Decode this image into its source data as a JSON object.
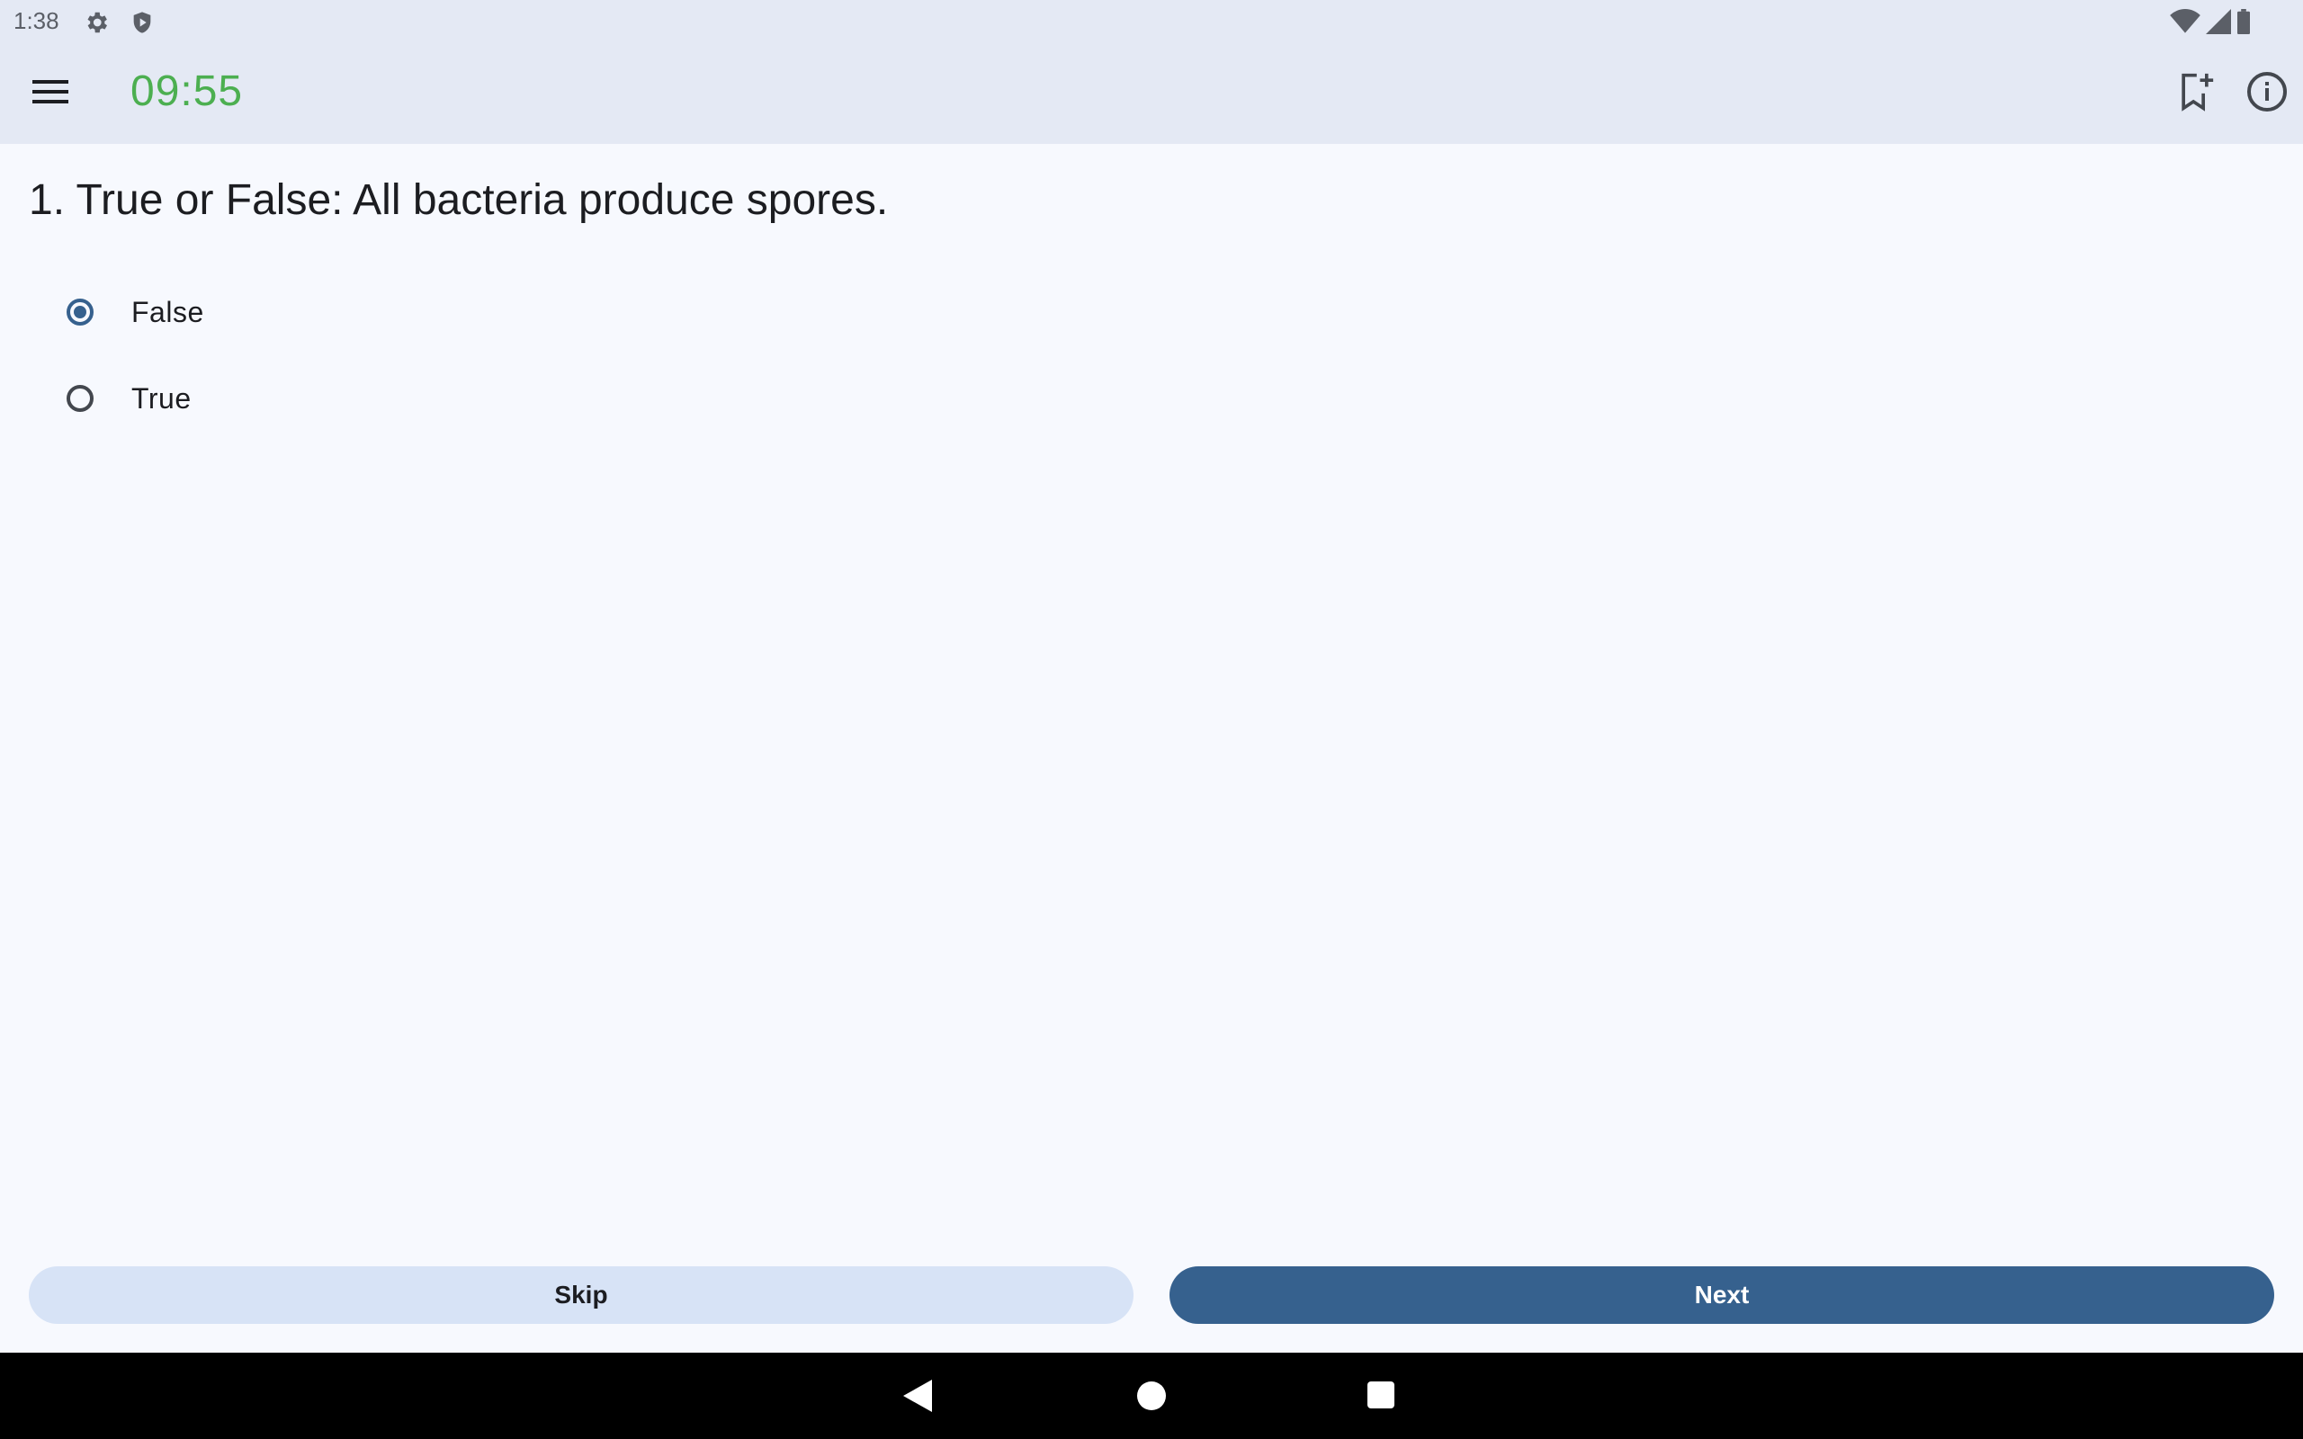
{
  "status_bar": {
    "time": "1:38",
    "icons": [
      "gear-icon",
      "shield-icon",
      "wifi-icon",
      "signal-icon",
      "battery-icon"
    ]
  },
  "app_bar": {
    "timer": "09:55",
    "timer_color": "#4caf50",
    "icons": [
      "menu-icon",
      "bookmark-add-icon",
      "info-icon"
    ]
  },
  "question": {
    "text": "1. True or False: All bacteria produce spores.",
    "options": [
      {
        "label": "False",
        "selected": true
      },
      {
        "label": "True",
        "selected": false
      }
    ]
  },
  "actions": {
    "skip_label": "Skip",
    "next_label": "Next"
  },
  "nav_bar": {
    "icons": [
      "back-icon",
      "home-icon",
      "recents-icon"
    ]
  },
  "colors": {
    "accent": "#36618e",
    "header_bg": "#e4e9f4",
    "page_bg": "#f7f9fe",
    "skip_bg": "#d7e3f6"
  }
}
